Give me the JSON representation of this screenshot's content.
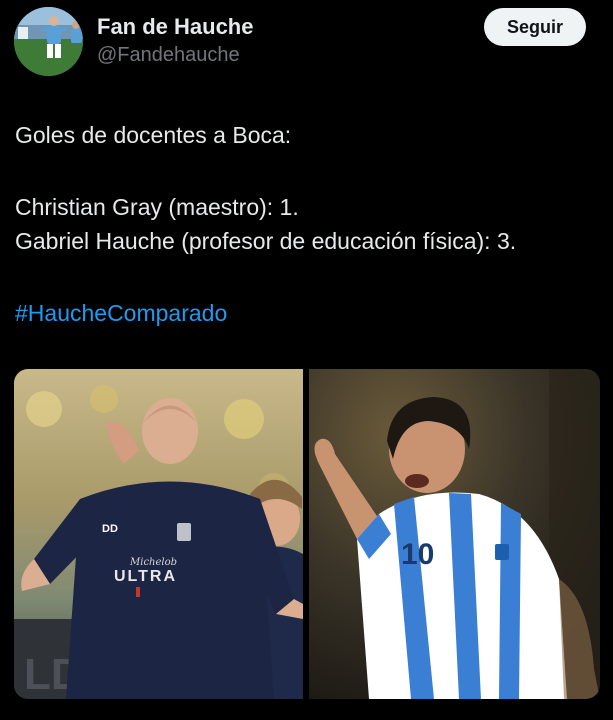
{
  "author": {
    "display_name": "Fan de Hauche",
    "handle": "@Fandehauche",
    "follow_label": "Seguir"
  },
  "tweet": {
    "lines": [
      "Goles de docentes a Boca:",
      "Christian Gray (maestro): 1.",
      "Gabriel Hauche (profesor de educación física): 3."
    ],
    "hashtag": "#HaucheComparado"
  },
  "media": {
    "left_photo": {
      "jersey_text_script": "Michelob",
      "jersey_text": "ULTRA"
    },
    "right_photo": {
      "shirt_number": "10"
    }
  },
  "colors": {
    "background": "#000000",
    "text": "#e7e9ea",
    "secondary_text": "#71767b",
    "link": "#1d9bf0",
    "button_bg": "#eff3f4"
  }
}
